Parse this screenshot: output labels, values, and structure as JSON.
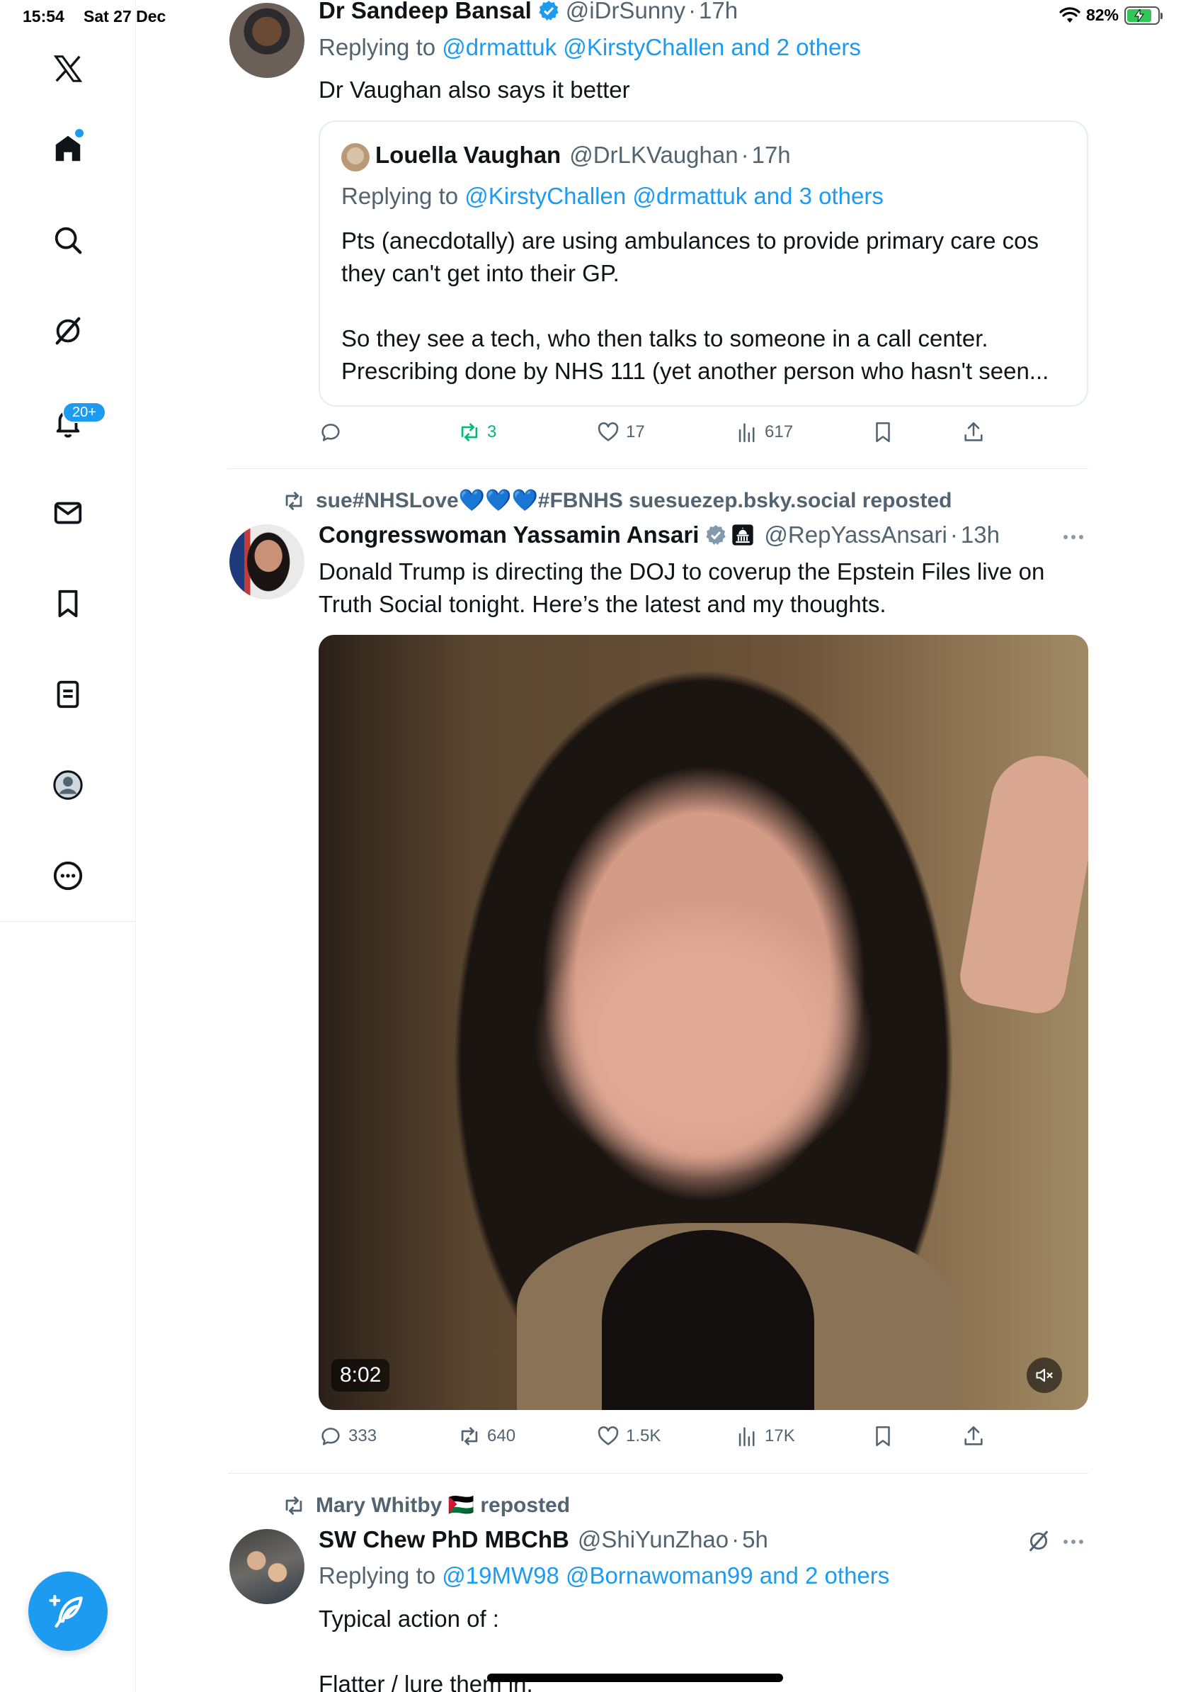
{
  "status_bar": {
    "time": "15:54",
    "date": "Sat 27 Dec",
    "battery": "82%"
  },
  "nav": {
    "notifications_badge": "20+",
    "accent": "#1d9bf0"
  },
  "tweets": [
    {
      "name": "Dr Sandeep Bansal",
      "handle": "@iDrSunny",
      "time": "17h",
      "reply_prefix": "Replying to",
      "reply_to": "@drmattuk @KirstyChallen and 2 others",
      "text": "Dr Vaughan also says it better",
      "quote": {
        "name": "Louella Vaughan",
        "handle": "@DrLKVaughan",
        "time": "17h",
        "reply_prefix": "Replying to",
        "reply_to": "@KirstyChallen @drmattuk and 3 others",
        "text": "Pts (anecdotally) are using ambulances to provide primary care cos they can't get into their GP.\n\nSo they see a tech, who then talks to someone in a call center. Prescribing done by NHS 111 (yet another person who hasn't seen..."
      },
      "stats": {
        "replies": "",
        "reposts": "3",
        "likes": "17",
        "views": "617"
      }
    },
    {
      "repost_label": "sue#NHSLove💙💙💙#FBNHS suesuezep.bsky.social reposted",
      "name": "Congresswoman Yassamin Ansari",
      "handle": "@RepYassAnsari",
      "time": "13h",
      "text": "Donald Trump is directing the DOJ to coverup the Epstein Files live on Truth Social tonight. Here’s the latest and my thoughts.",
      "video_duration": "8:02",
      "stats": {
        "replies": "333",
        "reposts": "640",
        "likes": "1.5K",
        "views": "17K"
      }
    },
    {
      "repost_label": "Mary Whitby 🇵🇸 reposted",
      "name": "SW Chew PhD MBChB",
      "handle": "@ShiYunZhao",
      "time": "5h",
      "reply_prefix": "Replying to",
      "reply_to": "@19MW98 @Bornawoman99 and 2 others",
      "text": "Typical action of :\n\nFlatter / lure them in."
    }
  ]
}
